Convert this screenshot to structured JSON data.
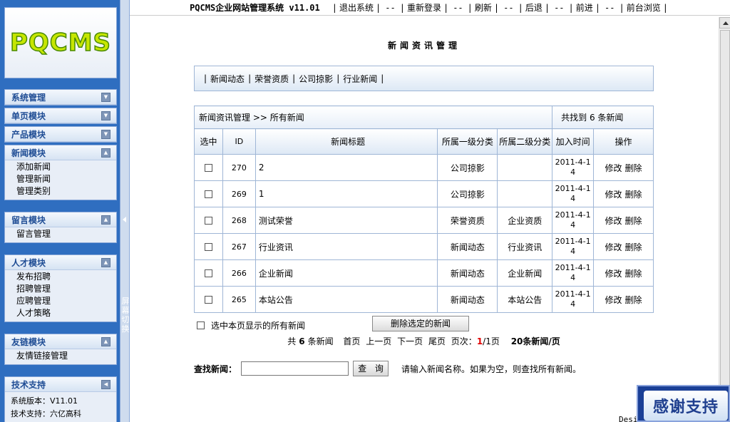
{
  "logo": "PQCMS",
  "topbar": {
    "title": "PQCMS企业网站管理系统 v11.01",
    "links": [
      "退出系统",
      "重新登录",
      "刷新",
      "后退",
      "前进",
      "前台浏览"
    ],
    "sep": "--"
  },
  "sidebar": {
    "groups": [
      {
        "label": "系统管理",
        "state": "collapsed",
        "items": []
      },
      {
        "label": "单页模块",
        "state": "collapsed",
        "items": []
      },
      {
        "label": "产品模块",
        "state": "collapsed",
        "items": []
      },
      {
        "label": "新闻模块",
        "state": "expanded",
        "items": [
          "添加新闻",
          "管理新闻",
          "管理类别"
        ]
      },
      {
        "label": "留言模块",
        "state": "expanded",
        "items": [
          "留言管理"
        ]
      },
      {
        "label": "人才模块",
        "state": "expanded",
        "items": [
          "发布招聘",
          "招聘管理",
          "应聘管理",
          "人才策略"
        ]
      },
      {
        "label": "友链模块",
        "state": "expanded",
        "items": [
          "友情链接管理"
        ]
      },
      {
        "label": "技术支持",
        "state": "side",
        "info": [
          "系统版本：V11.01",
          "技术支持：六亿高科"
        ]
      }
    ]
  },
  "screen_switch": "屏幕切换",
  "page_title": "新闻资讯管理",
  "categories": [
    "新闻动态",
    "荣誉资质",
    "公司掠影",
    "行业新闻"
  ],
  "table": {
    "breadcrumb": "新闻资讯管理 >> 所有新闻",
    "found": "共找到 6 条新闻",
    "headers": [
      "选中",
      "ID",
      "新闻标题",
      "所属一级分类",
      "所属二级分类",
      "加入时间",
      "操作"
    ],
    "rows": [
      {
        "id": "270",
        "title": "2",
        "cat1": "公司掠影",
        "cat2": "",
        "time": "2011-4-14"
      },
      {
        "id": "269",
        "title": "1",
        "cat1": "公司掠影",
        "cat2": "",
        "time": "2011-4-14"
      },
      {
        "id": "268",
        "title": "测试荣誉",
        "cat1": "荣誉资质",
        "cat2": "企业资质",
        "time": "2011-4-14"
      },
      {
        "id": "267",
        "title": "行业资讯",
        "cat1": "新闻动态",
        "cat2": "行业资讯",
        "time": "2011-4-14"
      },
      {
        "id": "266",
        "title": "企业新闻",
        "cat1": "新闻动态",
        "cat2": "企业新闻",
        "time": "2011-4-14"
      },
      {
        "id": "265",
        "title": "本站公告",
        "cat1": "新闻动态",
        "cat2": "本站公告",
        "time": "2011-4-14"
      }
    ],
    "edit_label": "修改",
    "delete_label": "删除"
  },
  "select_all_label": "选中本页显示的所有新闻",
  "delete_selected_label": "删除选定的新闻",
  "pager": {
    "total_prefix": "共",
    "total": "6",
    "total_suffix": "条新闻",
    "first": "首页",
    "prev": "上一页",
    "next": "下一页",
    "last": "尾页",
    "pages_prefix": "页次：",
    "current": "1",
    "total_pages": "/1页",
    "per_page": "20条新闻/页"
  },
  "search": {
    "label": "查找新闻：",
    "value": "",
    "button": "查 询",
    "hint": "请输入新闻名称。如果为空，则查找所有新闻。"
  },
  "footer": "Desi",
  "thanks": "感谢支持",
  "colors": {
    "sidebar_bg": "#2f6ec0",
    "header_text": "#1e4c94",
    "pager_current": "#e00000"
  }
}
